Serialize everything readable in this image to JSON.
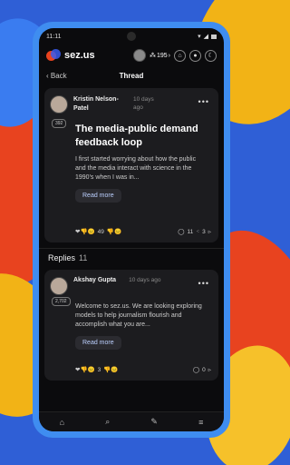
{
  "status": {
    "time": "11:11"
  },
  "app": {
    "logo_text": "sez.us",
    "points": "195"
  },
  "nav": {
    "back": "Back",
    "title": "Thread"
  },
  "post": {
    "author": "Kristin Nelson-Patel",
    "time": "10 days ago",
    "badge": "392",
    "title": "The media-public demand feedback loop",
    "body": "I first started worrying about how the public and the media interact with science in the 1990's when I was in...",
    "read_more": "Read more",
    "reaction_count": "49",
    "comment_count": "11",
    "share_count": "3"
  },
  "replies": {
    "label": "Replies",
    "count": "11",
    "item": {
      "author": "Akshay Gupta",
      "time": "10 days ago",
      "badge": "2,702",
      "body": "Welcome to sez.us. We are looking exploring models to help journalism flourish and accomplish what you are...",
      "read_more": "Read more",
      "reaction_count": "3",
      "comment_count": "0"
    }
  },
  "icons": {
    "home": "home-icon",
    "search": "search-icon",
    "edit": "edit-icon",
    "menu": "menu-icon"
  }
}
